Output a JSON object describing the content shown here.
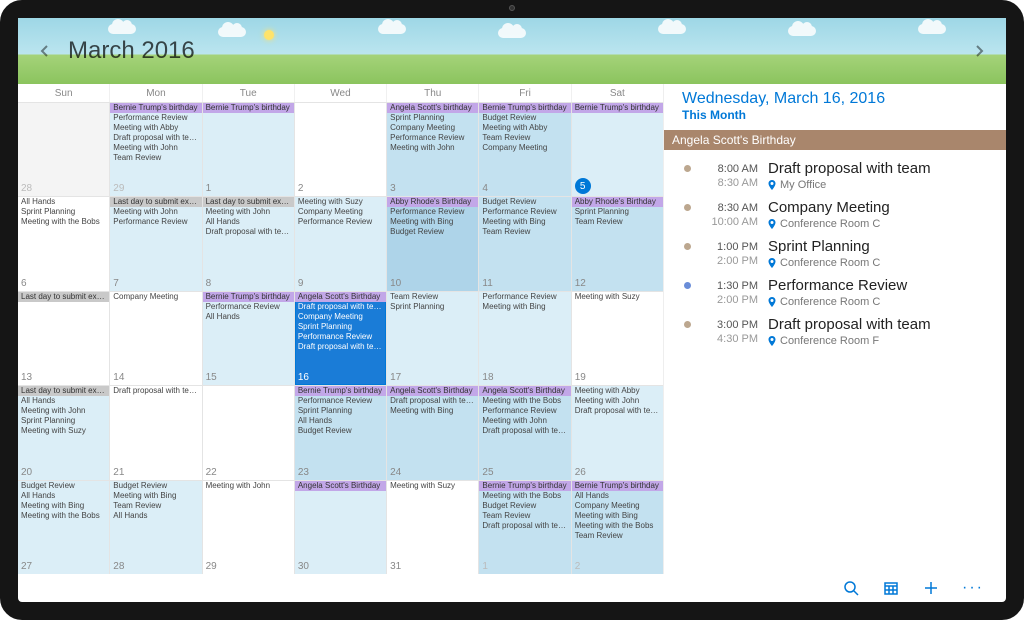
{
  "header": {
    "title": "March 2016"
  },
  "day_names": [
    "Sun",
    "Mon",
    "Tue",
    "Wed",
    "Thu",
    "Fri",
    "Sat"
  ],
  "weeks": [
    [
      {
        "date": "28",
        "dim": true,
        "events": []
      },
      {
        "date": "29",
        "dim": true,
        "tint": "tint1",
        "banner": {
          "text": "Bernie Trump's birthday",
          "style": "purple"
        },
        "events": [
          "Performance Review",
          "Meeting with Abby",
          "Draft proposal with team",
          "Meeting with John",
          "Team Review"
        ]
      },
      {
        "date": "1",
        "tint": "tint1",
        "banner": {
          "text": "Bernie Trump's birthday",
          "style": "purple"
        },
        "events": []
      },
      {
        "date": "2",
        "events": []
      },
      {
        "date": "3",
        "tint": "tint2",
        "banner": {
          "text": "Angela Scott's birthday",
          "style": "purple"
        },
        "events": [
          "Sprint Planning",
          "Company Meeting",
          "Performance Review",
          "Meeting with John"
        ]
      },
      {
        "date": "4",
        "tint": "tint2",
        "banner": {
          "text": "Bernie Trump's birthday",
          "style": "purple"
        },
        "events": [
          "Budget Review",
          "Meeting with Abby",
          "Team Review",
          "Company Meeting"
        ]
      },
      {
        "date": "5",
        "tint": "tint1",
        "today": true,
        "banner": {
          "text": "Bernie Trump's birthday",
          "style": "purple"
        },
        "events": []
      }
    ],
    [
      {
        "date": "6",
        "events": [
          "All Hands",
          "Sprint Planning",
          "Meeting with the Bobs"
        ]
      },
      {
        "date": "7",
        "tint": "tint1",
        "banner": {
          "text": "Last day to submit expense",
          "style": "grey"
        },
        "events": [
          "Meeting with John",
          "Performance Review"
        ]
      },
      {
        "date": "8",
        "tint": "tint1",
        "banner": {
          "text": "Last day to submit expense",
          "style": "grey"
        },
        "events": [
          "Meeting with John",
          "All Hands",
          "Draft proposal with team"
        ]
      },
      {
        "date": "9",
        "tint": "tint1",
        "events": [
          "Meeting with Suzy",
          "Company Meeting",
          "Performance Review"
        ]
      },
      {
        "date": "10",
        "tint": "tint3",
        "banner": {
          "text": "Abby Rhode's Birthday",
          "style": "purple"
        },
        "events": [
          "Performance Review",
          "Meeting with Bing",
          "Budget Review"
        ]
      },
      {
        "date": "11",
        "tint": "tint2",
        "events": [
          "Budget Review",
          "Performance Review",
          "Meeting with Bing",
          "Team Review"
        ]
      },
      {
        "date": "12",
        "tint": "tint2",
        "banner": {
          "text": "Abby Rhode's Birthday",
          "style": "purple"
        },
        "events": [
          "Sprint Planning",
          "Team Review"
        ]
      }
    ],
    [
      {
        "date": "13",
        "banner": {
          "text": "Last day to submit expense",
          "style": "grey"
        },
        "events": []
      },
      {
        "date": "14",
        "events": [
          "Company Meeting"
        ]
      },
      {
        "date": "15",
        "tint": "tint1",
        "banner": {
          "text": "Bernie Trump's birthday",
          "style": "purple"
        },
        "events": [
          "Performance Review",
          "All Hands"
        ]
      },
      {
        "date": "16",
        "selected": true,
        "banner": {
          "text": "Angela Scott's Birthday",
          "style": "purple"
        },
        "events": [
          "Draft proposal with team",
          "Company Meeting",
          "Sprint Planning",
          "Performance Review",
          "Draft proposal with team"
        ]
      },
      {
        "date": "17",
        "tint": "tint1",
        "events": [
          "Team Review",
          "Sprint Planning"
        ]
      },
      {
        "date": "18",
        "tint": "tint1",
        "events": [
          "Performance Review",
          "Meeting with Bing"
        ]
      },
      {
        "date": "19",
        "events": [
          "Meeting with Suzy"
        ]
      }
    ],
    [
      {
        "date": "20",
        "tint": "tint1",
        "banner": {
          "text": "Last day to submit expense",
          "style": "grey"
        },
        "events": [
          "All Hands",
          "Meeting with John",
          "Sprint Planning",
          "Meeting with Suzy"
        ]
      },
      {
        "date": "21",
        "events": [
          "Draft proposal with team"
        ]
      },
      {
        "date": "22",
        "events": []
      },
      {
        "date": "23",
        "tint": "tint2",
        "banner": {
          "text": "Bernie Trump's birthday",
          "style": "purple"
        },
        "events": [
          "Performance Review",
          "Sprint Planning",
          "All Hands",
          "Budget Review"
        ]
      },
      {
        "date": "24",
        "tint": "tint2",
        "banner": {
          "text": "Angela Scott's Birthday",
          "style": "purple"
        },
        "events": [
          "Draft proposal with team",
          "Meeting with Bing"
        ]
      },
      {
        "date": "25",
        "tint": "tint2",
        "banner": {
          "text": "Angela Scott's Birthday",
          "style": "purple"
        },
        "events": [
          "Meeting with the Bobs",
          "Performance Review",
          "Meeting with John",
          "Draft proposal with team"
        ]
      },
      {
        "date": "26",
        "tint": "tint1",
        "events": [
          "Meeting with Abby",
          "Meeting with John",
          "Draft proposal with team"
        ]
      }
    ],
    [
      {
        "date": "27",
        "tint": "tint1",
        "events": [
          "Budget Review",
          "All Hands",
          "Meeting with Bing",
          "Meeting with the Bobs"
        ]
      },
      {
        "date": "28",
        "tint": "tint1",
        "events": [
          "Budget Review",
          "Meeting with Bing",
          "Team Review",
          "All Hands"
        ]
      },
      {
        "date": "29",
        "events": [
          "Meeting with John"
        ]
      },
      {
        "date": "30",
        "tint": "tint1",
        "banner": {
          "text": "Angela Scott's Birthday",
          "style": "purple"
        },
        "events": []
      },
      {
        "date": "31",
        "events": [
          "Meeting with Suzy"
        ]
      },
      {
        "date": "1",
        "dim": true,
        "tint": "tint2",
        "banner": {
          "text": "Bernie Trump's birthday",
          "style": "purple"
        },
        "events": [
          "Meeting with the Bobs",
          "Budget Review",
          "Team Review",
          "Draft proposal with team"
        ]
      },
      {
        "date": "2",
        "dim": true,
        "tint": "tint2",
        "banner": {
          "text": "Bernie Trump's birthday",
          "style": "purple"
        },
        "events": [
          "All Hands",
          "Company Meeting",
          "Meeting with Bing",
          "Meeting with the Bobs",
          "Team Review"
        ]
      }
    ]
  ],
  "side": {
    "date": "Wednesday, March 16, 2016",
    "sub": "This Month",
    "allday": "Angela Scott's Birthday",
    "agenda": [
      {
        "start": "8:00 AM",
        "end": "8:30 AM",
        "title": "Draft proposal with team",
        "loc": "My Office",
        "dot": "brown"
      },
      {
        "start": "8:30 AM",
        "end": "10:00 AM",
        "title": "Company Meeting",
        "loc": "Conference Room C",
        "dot": "brown"
      },
      {
        "start": "1:00 PM",
        "end": "2:00 PM",
        "title": "Sprint Planning",
        "loc": "Conference Room C",
        "dot": "brown"
      },
      {
        "start": "1:30 PM",
        "end": "2:00 PM",
        "title": "Performance Review",
        "loc": "Conference Room C",
        "dot": "blue"
      },
      {
        "start": "3:00 PM",
        "end": "4:30 PM",
        "title": "Draft proposal with team",
        "loc": "Conference Room F",
        "dot": "brown"
      }
    ]
  }
}
